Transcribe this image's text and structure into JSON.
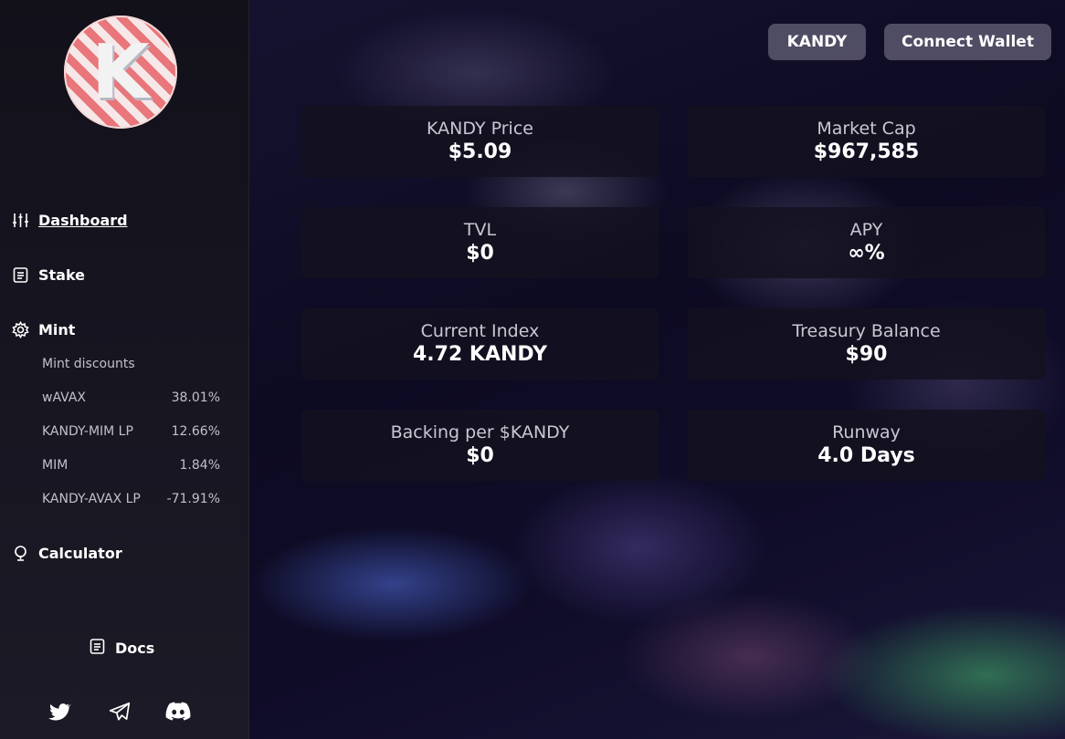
{
  "logo": {
    "letter": "K"
  },
  "sidebar": {
    "nav": [
      {
        "label": "Dashboard",
        "icon": "sliders-icon",
        "active": true
      },
      {
        "label": "Stake",
        "icon": "document-icon"
      },
      {
        "label": "Mint",
        "icon": "gear-icon"
      },
      {
        "label": "Calculator",
        "icon": "globe-icon"
      }
    ],
    "mint_discounts": {
      "title": "Mint discounts",
      "items": [
        {
          "name": "wAVAX",
          "value": "38.01%"
        },
        {
          "name": "KANDY-MIM LP",
          "value": "12.66%"
        },
        {
          "name": "MIM",
          "value": "1.84%"
        },
        {
          "name": "KANDY-AVAX LP",
          "value": "-71.91%"
        }
      ]
    },
    "docs_label": "Docs",
    "social": [
      "twitter-icon",
      "telegram-icon",
      "discord-icon"
    ]
  },
  "header": {
    "token_button": "KANDY",
    "wallet_button": "Connect Wallet"
  },
  "stats": [
    {
      "title": "KANDY Price",
      "value": "$5.09"
    },
    {
      "title": "Market Cap",
      "value": "$967,585"
    },
    {
      "title": "TVL",
      "value": "$0"
    },
    {
      "title": "APY",
      "value": "∞%"
    },
    {
      "title": "Current Index",
      "value": "4.72 KANDY"
    },
    {
      "title": "Treasury Balance",
      "value": "$90"
    },
    {
      "title": "Backing per $KANDY",
      "value": "$0"
    },
    {
      "title": "Runway",
      "value": "4.0 Days"
    }
  ]
}
